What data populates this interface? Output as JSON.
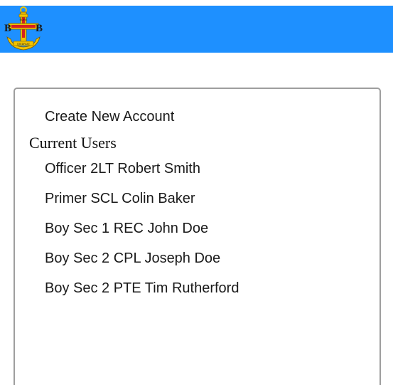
{
  "header": {
    "background_color": "#1e90ff",
    "logo": {
      "icon": "boys-brigade-anchor-logo-icon",
      "letters_left": "B",
      "letters_right": "B",
      "motto": "SURE",
      "ribbon_text": "STEDFAST"
    }
  },
  "panel": {
    "create_link_label": "Create New Account",
    "section_heading": "Current Users",
    "users": [
      {
        "label": "Officer 2LT Robert Smith"
      },
      {
        "label": "Primer SCL Colin Baker"
      },
      {
        "label": "Boy Sec 1 REC John Doe"
      },
      {
        "label": "Boy Sec 2 CPL Joseph Doe"
      },
      {
        "label": "Boy Sec 2 PTE Tim Rutherford"
      }
    ]
  }
}
